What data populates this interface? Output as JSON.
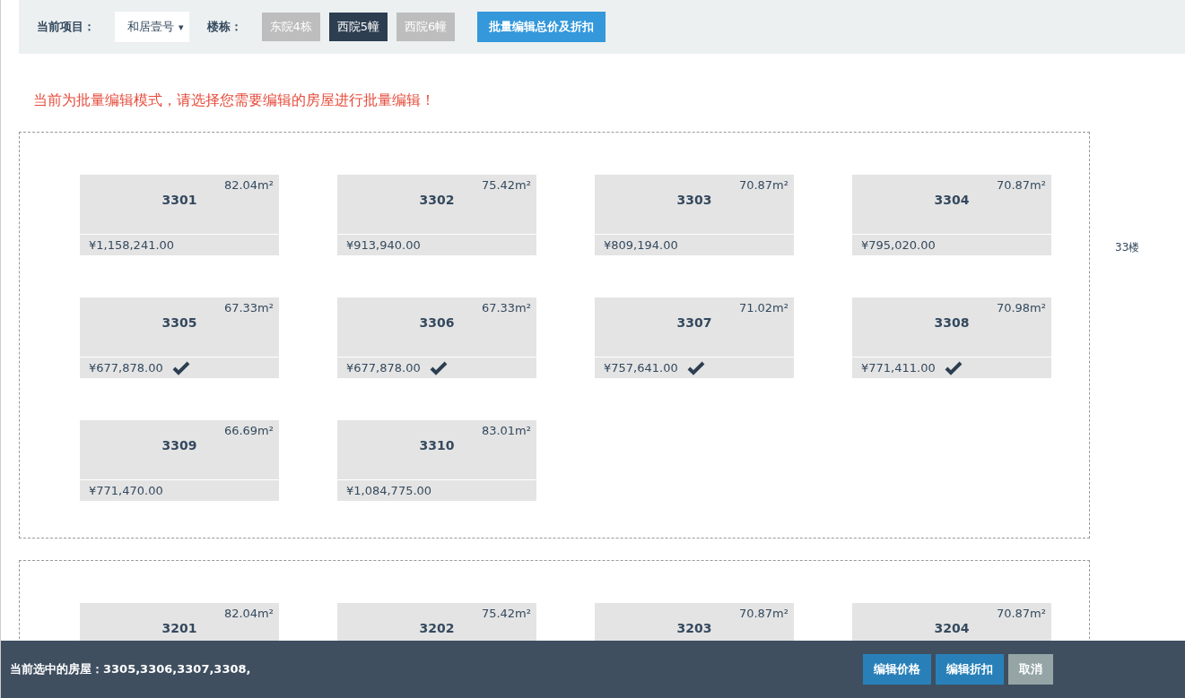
{
  "toolbar": {
    "project_label": "当前项目：",
    "project": {
      "value": "和居壹号",
      "caret": "▾"
    },
    "building_label": "楼栋：",
    "buildings": [
      {
        "label": "东院4栋",
        "selected": false
      },
      {
        "label": "西院5幢",
        "selected": true
      },
      {
        "label": "西院6幢",
        "selected": false
      }
    ],
    "batch_button": "批量编辑总价及折扣"
  },
  "notice": "当前为批量编辑模式，请选择您需要编辑的房屋进行批量编辑！",
  "floors": [
    {
      "label": "33楼",
      "rooms": [
        {
          "number": "3301",
          "area": "82.04m²",
          "price": "¥1,158,241.00",
          "selected": false
        },
        {
          "number": "3302",
          "area": "75.42m²",
          "price": "¥913,940.00",
          "selected": false
        },
        {
          "number": "3303",
          "area": "70.87m²",
          "price": "¥809,194.00",
          "selected": false
        },
        {
          "number": "3304",
          "area": "70.87m²",
          "price": "¥795,020.00",
          "selected": false
        },
        {
          "number": "3305",
          "area": "67.33m²",
          "price": "¥677,878.00",
          "selected": true
        },
        {
          "number": "3306",
          "area": "67.33m²",
          "price": "¥677,878.00",
          "selected": true
        },
        {
          "number": "3307",
          "area": "71.02m²",
          "price": "¥757,641.00",
          "selected": true
        },
        {
          "number": "3308",
          "area": "70.98m²",
          "price": "¥771,411.00",
          "selected": true
        },
        {
          "number": "3309",
          "area": "66.69m²",
          "price": "¥771,470.00",
          "selected": false
        },
        {
          "number": "3310",
          "area": "83.01m²",
          "price": "¥1,084,775.00",
          "selected": false
        }
      ]
    },
    {
      "rooms": [
        {
          "number": "3201",
          "area": "82.04m²"
        },
        {
          "number": "3202",
          "area": "75.42m²"
        },
        {
          "number": "3203",
          "area": "70.87m²"
        },
        {
          "number": "3204",
          "area": "70.87m²"
        }
      ]
    }
  ],
  "bottom_bar": {
    "selection": "当前选中的房屋：3305,3306,3307,3308,",
    "buttons": [
      {
        "label": "编辑价格",
        "kind": "primary"
      },
      {
        "label": "编辑折扣",
        "kind": "primary"
      },
      {
        "label": "取消",
        "kind": "muted"
      }
    ]
  }
}
